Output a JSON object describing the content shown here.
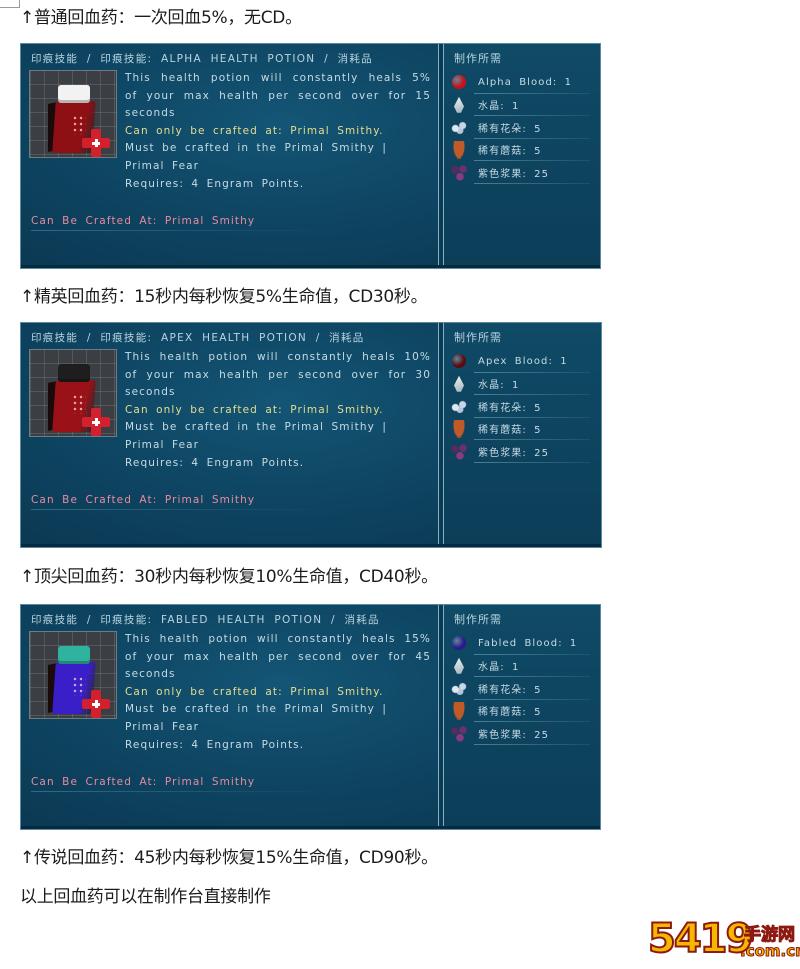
{
  "captions": {
    "alpha": "↑普通回血药：一次回血5%，无CD。",
    "apex": "↑精英回血药：15秒内每秒恢复5%生命值，CD30秒。",
    "fabled": "↑顶尖回血药：30秒内每秒恢复10%生命值，CD40秒。",
    "legendary": "↑传说回血药：45秒内每秒恢复15%生命值，CD90秒。",
    "footer": "以上回血药可以在制作台直接制作"
  },
  "panels": [
    {
      "breadcrumb": "印痕技能  /  印痕技能: ALPHA HEALTH POTION  /  消耗品",
      "potion_icon": "alpha-health-potion-icon",
      "bottle_color": "#8e0f14",
      "cap_color": "#f2f2f2",
      "desc_line1": "This health potion will constantly heals 5%",
      "desc_line2": "of your max health per second over for 15",
      "desc_line3": "seconds",
      "craft_only": "Can only be crafted at: Primal Smithy.",
      "must_line1": "Must be crafted in the Primal Smithy |",
      "must_line2": "Primal Fear",
      "requires": "Requires: 4 Engram Points.",
      "crafted_at": "Can Be Crafted At: Primal Smithy",
      "requirements_title": "制作所需",
      "blood_color": "#c8101a",
      "requirements": [
        {
          "icon": "alpha-blood-icon",
          "text": "Alpha Blood: 1"
        },
        {
          "icon": "crystal-icon",
          "text": "水晶: 1"
        },
        {
          "icon": "rare-flower-icon",
          "text": "稀有花朵: 5"
        },
        {
          "icon": "rare-mushroom-icon",
          "text": "稀有蘑菇: 5"
        },
        {
          "icon": "purple-berry-icon",
          "text": "紫色浆果: 25"
        }
      ]
    },
    {
      "breadcrumb": "印痕技能  /  印痕技能: APEX HEALTH POTION  /  消耗品",
      "potion_icon": "apex-health-potion-icon",
      "bottle_color": "#9a1218",
      "cap_color": "#1e1e1e",
      "desc_line1": "This health potion will constantly heals 10%",
      "desc_line2": "of your max health per second over for 30",
      "desc_line3": "seconds",
      "craft_only": "Can only be crafted at: Primal Smithy.",
      "must_line1": "Must be crafted in the Primal Smithy |",
      "must_line2": "Primal Fear",
      "requires": "Requires: 4 Engram Points.",
      "crafted_at": "Can Be Crafted At: Primal Smithy",
      "requirements_title": "制作所需",
      "blood_color": "#5a0a10",
      "requirements": [
        {
          "icon": "apex-blood-icon",
          "text": "Apex Blood: 1"
        },
        {
          "icon": "crystal-icon",
          "text": "水晶: 1"
        },
        {
          "icon": "rare-flower-icon",
          "text": "稀有花朵: 5"
        },
        {
          "icon": "rare-mushroom-icon",
          "text": "稀有蘑菇: 5"
        },
        {
          "icon": "purple-berry-icon",
          "text": "紫色浆果: 25"
        }
      ]
    },
    {
      "breadcrumb": "印痕技能  /  印痕技能: FABLED HEALTH POTION  /  消耗品",
      "potion_icon": "fabled-health-potion-icon",
      "bottle_color": "#3a1ec8",
      "cap_color": "#2fb3a0",
      "desc_line1": "This health potion will constantly heals 15%",
      "desc_line2": "of your max health per second over for 45",
      "desc_line3": "seconds",
      "craft_only": "Can only be crafted at: Primal Smithy.",
      "must_line1": "Must be crafted in the Primal Smithy |",
      "must_line2": "Primal Fear",
      "requires": "Requires: 4 Engram Points.",
      "crafted_at": "Can Be Crafted At: Primal Smithy",
      "requirements_title": "制作所需",
      "blood_color": "#2a1a8a",
      "requirements": [
        {
          "icon": "fabled-blood-icon",
          "text": "Fabled Blood: 1"
        },
        {
          "icon": "crystal-icon",
          "text": "水晶: 1"
        },
        {
          "icon": "rare-flower-icon",
          "text": "稀有花朵: 5"
        },
        {
          "icon": "rare-mushroom-icon",
          "text": "稀有蘑菇: 5"
        },
        {
          "icon": "purple-berry-icon",
          "text": "紫色浆果: 25"
        }
      ]
    }
  ],
  "watermark": {
    "number": "5419",
    "name": "手游网",
    "domain": ".com.cn"
  }
}
